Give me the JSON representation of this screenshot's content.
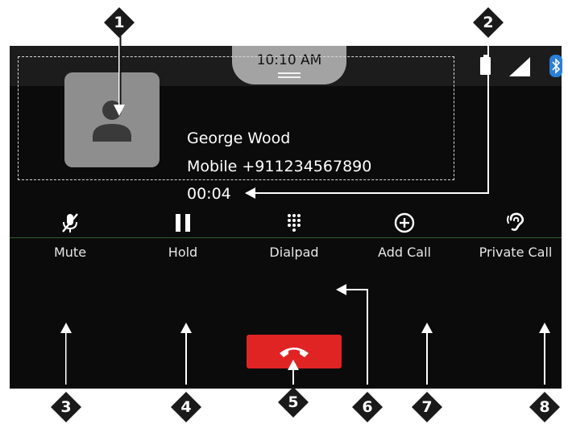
{
  "status_bar": {
    "time": "10:10 AM",
    "icons": [
      "battery-icon",
      "signal-icon",
      "bluetooth-icon"
    ]
  },
  "caller": {
    "name": "George Wood",
    "number_line": "Mobile  +911234567890",
    "duration": "00:04"
  },
  "actions": [
    {
      "label": "Mute",
      "icon": "mic-off-icon"
    },
    {
      "label": "Hold",
      "icon": "pause-icon"
    },
    {
      "label": "Dialpad",
      "icon": "dialpad-icon"
    },
    {
      "label": "Add Call",
      "icon": "add-circle-icon"
    },
    {
      "label": "Private Call",
      "icon": "ear-icon"
    }
  ],
  "end_call": {
    "icon": "phone-hangup-icon",
    "color": "#e02424"
  },
  "callouts": [
    "1",
    "2",
    "3",
    "4",
    "5",
    "6",
    "7",
    "8"
  ]
}
